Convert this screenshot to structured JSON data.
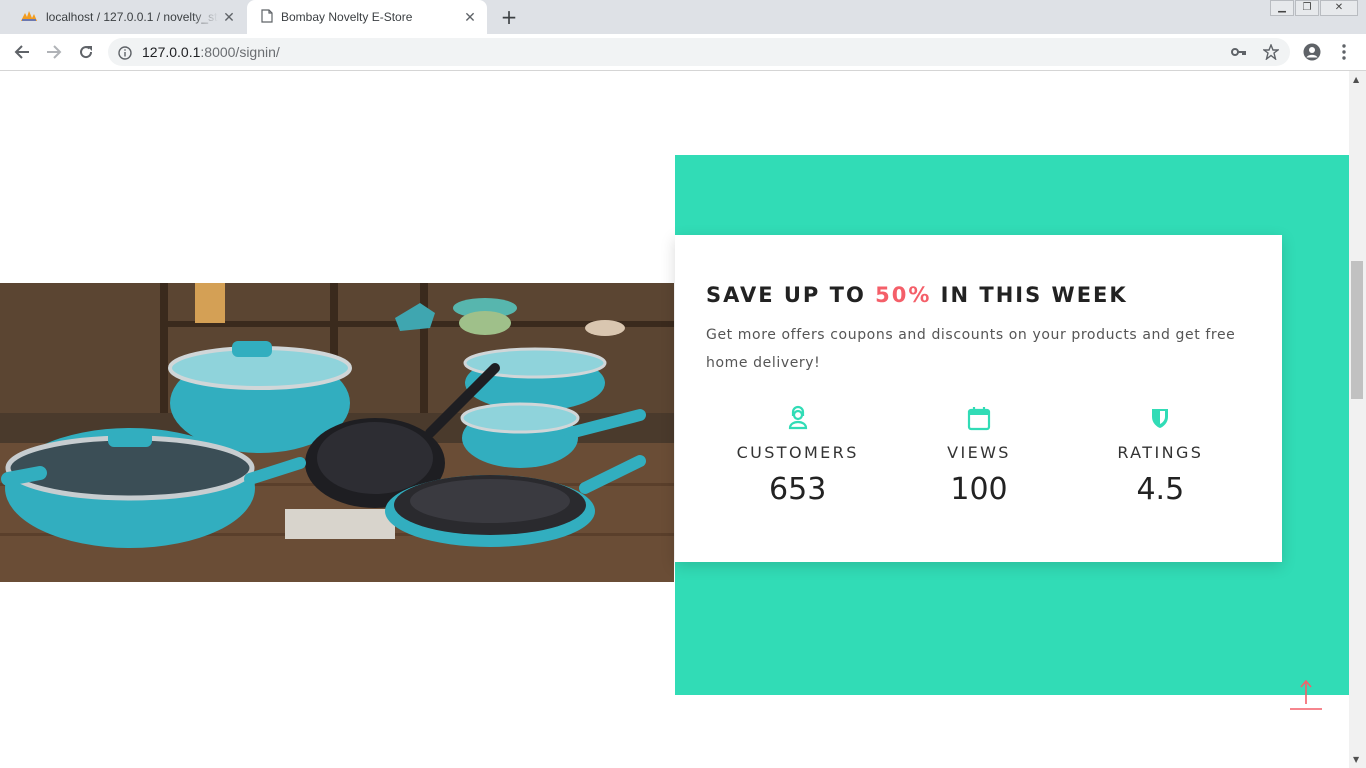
{
  "browser": {
    "tabs": [
      {
        "title": "localhost / 127.0.0.1 / novelty_store",
        "icon": "phpmyadmin-icon",
        "active": false
      },
      {
        "title": "Bombay Novelty E-Store",
        "icon": "page-icon",
        "active": true
      }
    ],
    "address": {
      "host": "127.0.0.1",
      "rest": ":8000/signin/"
    }
  },
  "promo": {
    "headline_pre": "SAVE UP TO ",
    "headline_highlight": "50%",
    "headline_post": " IN THIS WEEK",
    "description": "Get more offers coupons and discounts on your products and get free home delivery!",
    "highlight_color": "#f45f69",
    "panel_color": "#31dcb6"
  },
  "stats": [
    {
      "icon": "user-icon",
      "label": "CUSTOMERS",
      "value": "653"
    },
    {
      "icon": "calendar-icon",
      "label": "VIEWS",
      "value": "100"
    },
    {
      "icon": "shield-icon",
      "label": "RATINGS",
      "value": "4.5"
    }
  ],
  "hero_image": {
    "alt": "turquoise cookware set"
  }
}
